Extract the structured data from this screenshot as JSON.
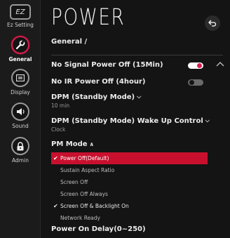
{
  "sidebar": {
    "items": [
      {
        "label": "Ez Setting",
        "icon": "ez-icon",
        "glyph": "EZ"
      },
      {
        "label": "General",
        "icon": "wrench-icon",
        "active": true
      },
      {
        "label": "Display",
        "icon": "display-icon"
      },
      {
        "label": "Sound",
        "icon": "speaker-icon"
      },
      {
        "label": "Admin",
        "icon": "lock-icon"
      }
    ]
  },
  "header": {
    "title": "POWER",
    "breadcrumb": "General /",
    "back_icon": "back-icon"
  },
  "settings": {
    "no_signal": {
      "label": "No Signal Power Off (15Min)",
      "toggle": "on"
    },
    "no_ir": {
      "label": "No IR Power Off (4hour)",
      "toggle": "off"
    },
    "dpm": {
      "label": "DPM (Standby Mode)",
      "value": "10 min"
    },
    "dpm_wake": {
      "label": "DPM (Standby Mode) Wake Up Control",
      "value": "Clock"
    },
    "pm_mode": {
      "label": "PM Mode",
      "options": [
        "Power Off(Default)",
        "Sustain Aspect Ratio",
        "Screen Off",
        "Screen Off Always",
        "Screen Off & Backlight On",
        "Network Ready"
      ]
    },
    "power_on_delay": {
      "label": "Power On Delay(0~250)"
    }
  },
  "colors": {
    "accent": "#c8102e",
    "background": "#141414"
  }
}
